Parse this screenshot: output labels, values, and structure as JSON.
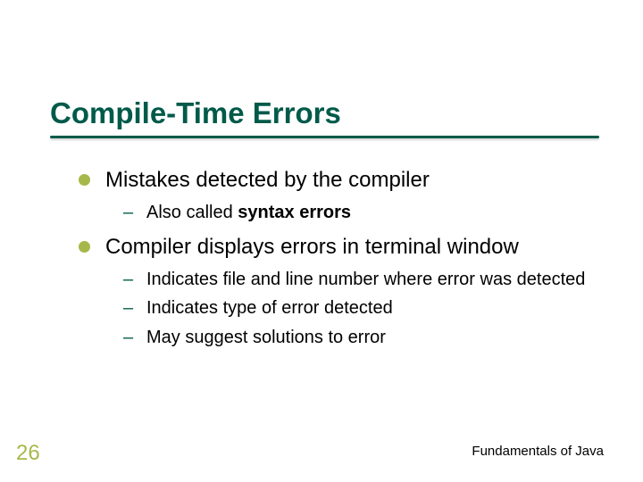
{
  "title": "Compile-Time Errors",
  "bullets": [
    {
      "text": "Mistakes detected by the compiler",
      "sub": [
        {
          "pre": "Also called ",
          "bold": "syntax errors"
        }
      ]
    },
    {
      "text": "Compiler displays errors in terminal window",
      "sub": [
        {
          "pre": "Indicates file and line number where error was detected"
        },
        {
          "pre": "Indicates type of error detected"
        },
        {
          "pre": "May suggest solutions to error"
        }
      ]
    }
  ],
  "page_number": "26",
  "footer": "Fundamentals of Java"
}
